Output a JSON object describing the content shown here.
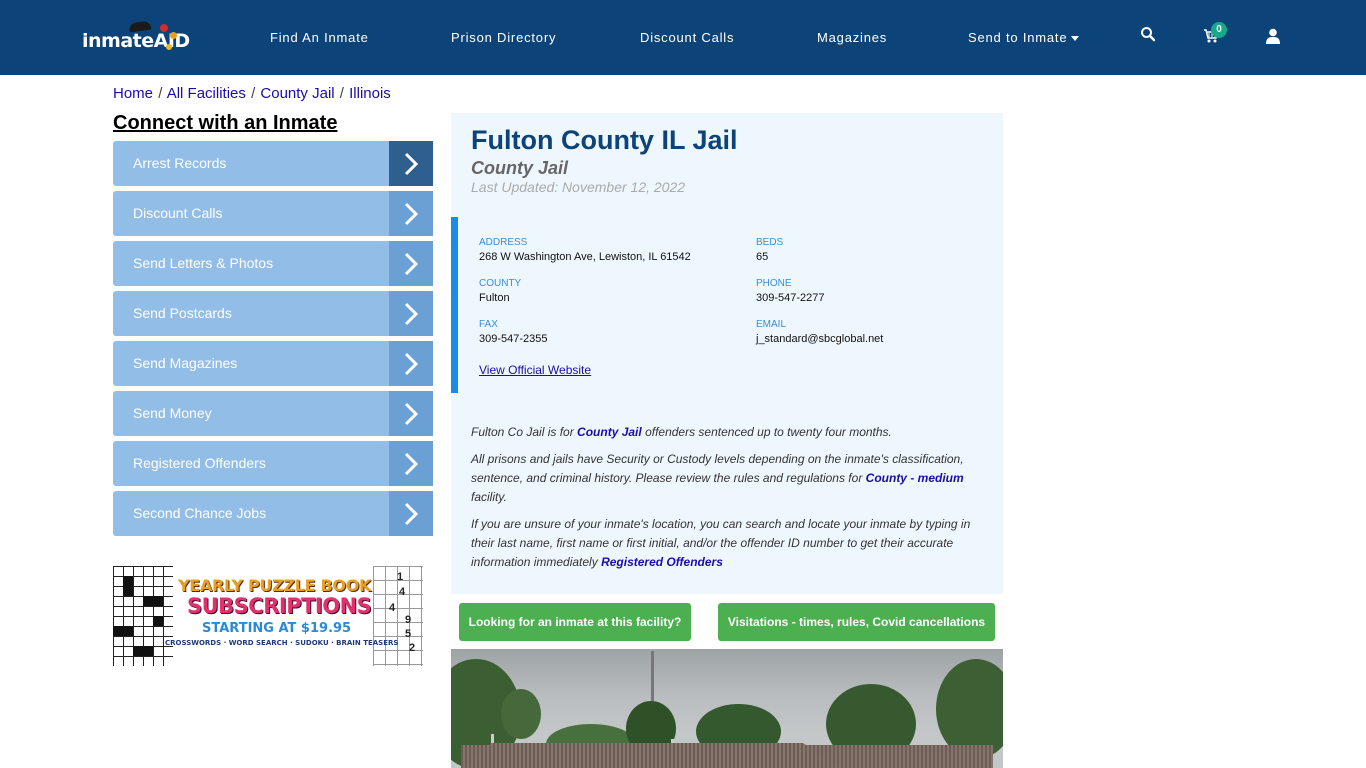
{
  "header": {
    "logo_text": "inmate",
    "logo_accent": "AID",
    "nav": [
      {
        "label": "Find An Inmate"
      },
      {
        "label": "Prison Directory"
      },
      {
        "label": "Discount Calls"
      },
      {
        "label": "Magazines"
      },
      {
        "label": "Send to Inmate",
        "has_dropdown": true
      }
    ],
    "icons": {
      "search": "search-icon",
      "cart": "cart-icon",
      "user": "user-icon"
    },
    "cart_count": "0",
    "colors": {
      "bar": "#0c4378",
      "badge": "#17a98a"
    }
  },
  "breadcrumb": [
    {
      "label": "Home"
    },
    {
      "label": "All Facilities"
    },
    {
      "label": "County Jail"
    },
    {
      "label": "Illinois"
    }
  ],
  "sidebar": {
    "title": "Connect with an Inmate",
    "items": [
      {
        "label": "Arrest Records",
        "active": true
      },
      {
        "label": "Discount Calls"
      },
      {
        "label": "Send Letters & Photos"
      },
      {
        "label": "Send Postcards"
      },
      {
        "label": "Send Magazines"
      },
      {
        "label": "Send Money"
      },
      {
        "label": "Registered Offenders"
      },
      {
        "label": "Second Chance Jobs"
      }
    ],
    "ad": {
      "line1": "YEARLY PUZZLE BOOK",
      "line2": "SUBSCRIPTIONS",
      "line3": "STARTING AT $19.95",
      "line4": "CROSSWORDS · WORD SEARCH · SUDOKU · BRAIN TEASERS",
      "numbers": [
        "1",
        "4",
        "4",
        "9",
        "5",
        "2"
      ]
    }
  },
  "facility": {
    "name": "Fulton County IL Jail",
    "type": "County Jail",
    "last_updated": "Last Updated: November 12, 2022",
    "info": {
      "address_label": "ADDRESS",
      "address": "268 W Washington Ave, Lewiston, IL 61542",
      "beds_label": "BEDS",
      "beds": "65",
      "county_label": "COUNTY",
      "county": "Fulton",
      "phone_label": "PHONE",
      "phone": "309-547-2277",
      "fax_label": "FAX",
      "fax": "309-547-2355",
      "email_label": "EMAIL",
      "email": "j_standard@sbcglobal.net",
      "website_link": "View Official Website"
    },
    "description": {
      "p1_before": "Fulton Co Jail is for ",
      "p1_link": "County Jail",
      "p1_after": " offenders sentenced up to twenty four months.",
      "p2_before": "All prisons and jails have Security or Custody levels depending on the inmate's classification, sentence, and criminal history. Please review the rules and regulations for ",
      "p2_link": "County - medium",
      "p2_after": " facility.",
      "p3_before": "If you are unsure of your inmate's location, you can search and locate your inmate by typing in their last name, first name or first initial, and/or the offender ID number to get their accurate information immediately ",
      "p3_link": "Registered Offenders"
    },
    "buttons": {
      "looking": "Looking for an inmate at this facility?",
      "visitations": "Visitations - times, rules, Covid cancellations"
    },
    "photo": "facility-photo"
  }
}
